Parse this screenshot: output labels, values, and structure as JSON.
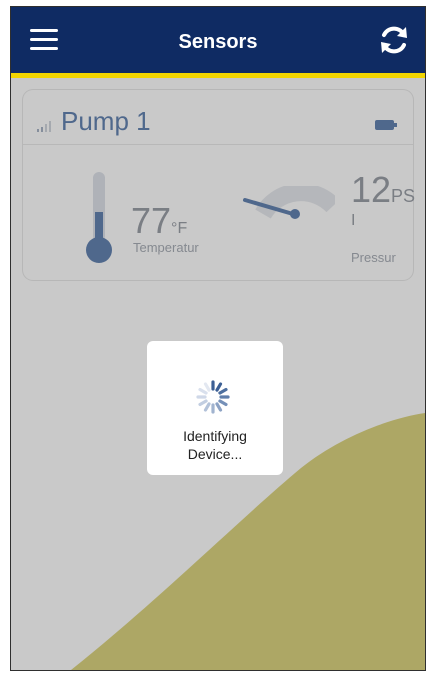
{
  "header": {
    "title": "Sensors",
    "background": "#0f2b63",
    "accent": "#f2d500"
  },
  "icons": {
    "menu": "hamburger-menu-icon",
    "refresh": "refresh-icon",
    "signal": "signal-strength-icon",
    "battery": "battery-icon",
    "thermometer": "thermometer-icon",
    "gauge": "pressure-gauge-icon",
    "spinner": "loading-spinner-icon"
  },
  "sensor_card": {
    "device_name": "Pump 1",
    "temperature": {
      "value": "77",
      "unit": "°F",
      "label": "Temperatur"
    },
    "pressure": {
      "value": "12",
      "unit": "PS",
      "unit_line2": "I",
      "label": "Pressur"
    }
  },
  "loading_dialog": {
    "line1": "Identifying",
    "line2": "Device..."
  },
  "colors": {
    "wave": "#d5cc6a",
    "device_name": "#4a6fa5",
    "overlay": "rgba(90,90,90,0.33)"
  }
}
